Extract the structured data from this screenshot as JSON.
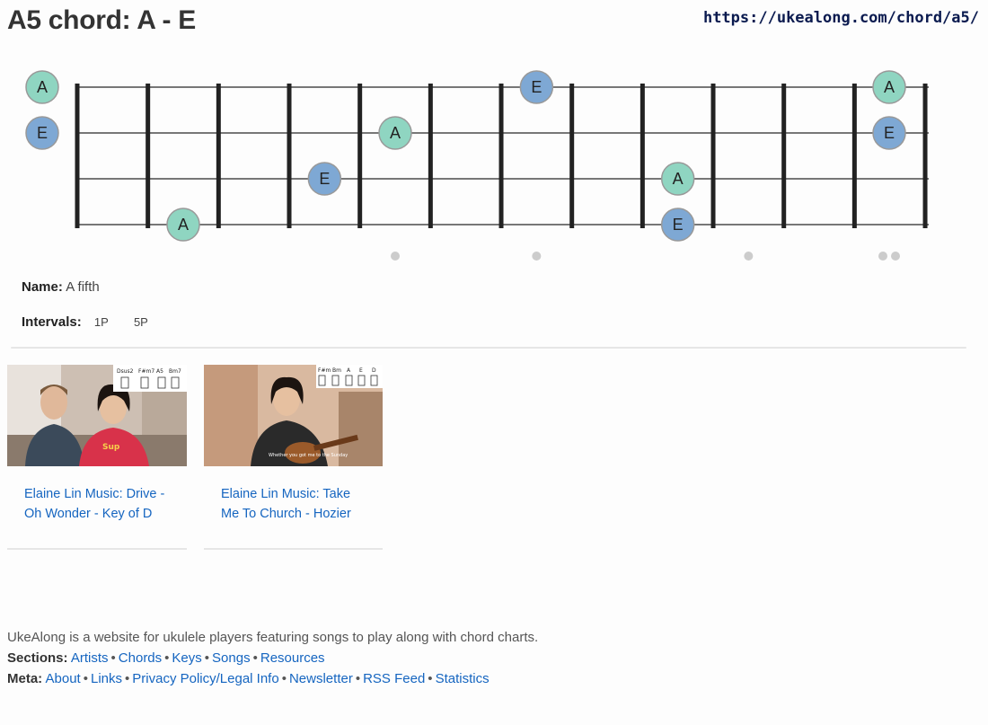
{
  "page": {
    "title": "A5 chord: A - E",
    "url": "https://ukealong.com/chord/a5/"
  },
  "fretboard": {
    "frets": 12,
    "strings": 4,
    "open_notes": [
      {
        "string": 1,
        "label": "A",
        "kind": "root"
      },
      {
        "string": 2,
        "label": "E",
        "kind": "fifth"
      }
    ],
    "notes": [
      {
        "string": 1,
        "fret": 7,
        "label": "E",
        "kind": "fifth"
      },
      {
        "string": 1,
        "fret": 12,
        "label": "A",
        "kind": "root"
      },
      {
        "string": 2,
        "fret": 5,
        "label": "A",
        "kind": "root"
      },
      {
        "string": 2,
        "fret": 12,
        "label": "E",
        "kind": "fifth"
      },
      {
        "string": 3,
        "fret": 4,
        "label": "E",
        "kind": "fifth"
      },
      {
        "string": 3,
        "fret": 9,
        "label": "A",
        "kind": "root"
      },
      {
        "string": 4,
        "fret": 2,
        "label": "A",
        "kind": "root"
      },
      {
        "string": 4,
        "fret": 9,
        "label": "E",
        "kind": "fifth"
      }
    ],
    "markers": [
      5,
      7,
      10,
      12
    ],
    "colors": {
      "root": "#8fd5c1",
      "fifth": "#7ea8d4",
      "wire": "#222222",
      "string": "#777777",
      "marker": "#cccccc"
    }
  },
  "info": {
    "name_label": "Name:",
    "name_value": "A fifth",
    "intervals_label": "Intervals:",
    "intervals": [
      "1P",
      "5P"
    ]
  },
  "videos": [
    {
      "title": "Elaine Lin Music: Drive - Oh Wonder - Key of D",
      "chords": [
        "Dsus2",
        "F#m7",
        "A5",
        "Bm7"
      ]
    },
    {
      "title": "Elaine Lin Music: Take Me To Church - Hozier",
      "chords": [
        "F#m",
        "Bm",
        "A",
        "E",
        "D"
      ]
    }
  ],
  "footer": {
    "description": "UkeAlong is a website for ukulele players featuring songs to play along with chord charts.",
    "sections_label": "Sections:",
    "sections": [
      "Artists",
      "Chords",
      "Keys",
      "Songs",
      "Resources"
    ],
    "meta_label": "Meta:",
    "meta": [
      "About",
      "Links",
      "Privacy Policy/Legal Info",
      "Newsletter",
      "RSS Feed",
      "Statistics"
    ]
  }
}
